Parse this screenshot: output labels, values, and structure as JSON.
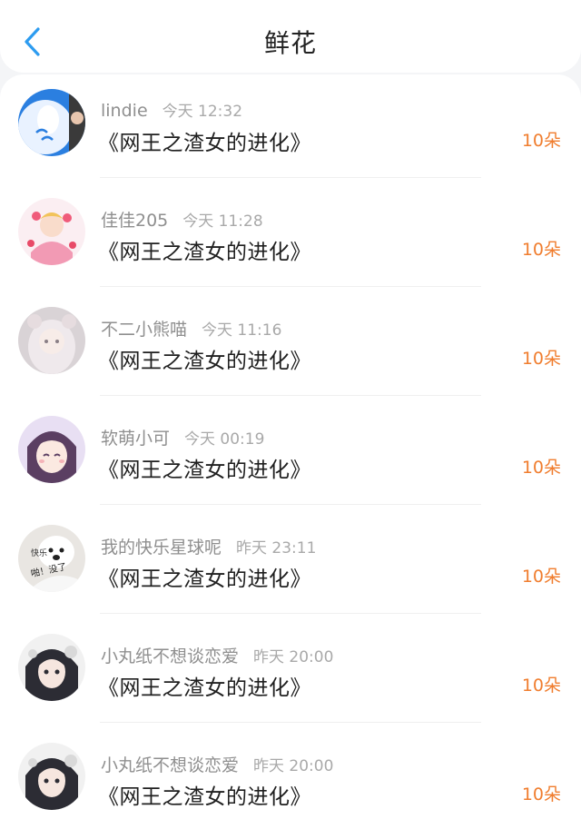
{
  "header": {
    "title": "鲜花",
    "back_icon": "chevron-left-icon",
    "accent_color": "#2d9cf0"
  },
  "list": [
    {
      "name": "lindie",
      "time": "今天 12:32",
      "book": "《网王之渣女的进化》",
      "count": "10朵"
    },
    {
      "name": "佳佳205",
      "time": "今天 11:28",
      "book": "《网王之渣女的进化》",
      "count": "10朵"
    },
    {
      "name": "不二小熊喵",
      "time": "今天 11:16",
      "book": "《网王之渣女的进化》",
      "count": "10朵"
    },
    {
      "name": "软萌小可",
      "time": "今天 00:19",
      "book": "《网王之渣女的进化》",
      "count": "10朵"
    },
    {
      "name": "我的快乐星球呢",
      "time": "昨天 23:11",
      "book": "《网王之渣女的进化》",
      "count": "10朵",
      "avatar_text": [
        "快乐",
        "啪！没了"
      ]
    },
    {
      "name": "小丸纸不想谈恋爱",
      "time": "昨天 20:00",
      "book": "《网王之渣女的进化》",
      "count": "10朵"
    },
    {
      "name": "小丸纸不想谈恋爱",
      "time": "昨天 20:00",
      "book": "《网王之渣女的进化》",
      "count": "10朵"
    }
  ],
  "colors": {
    "count_text": "#f07d2e",
    "meta_text": "#8f8f8f"
  }
}
